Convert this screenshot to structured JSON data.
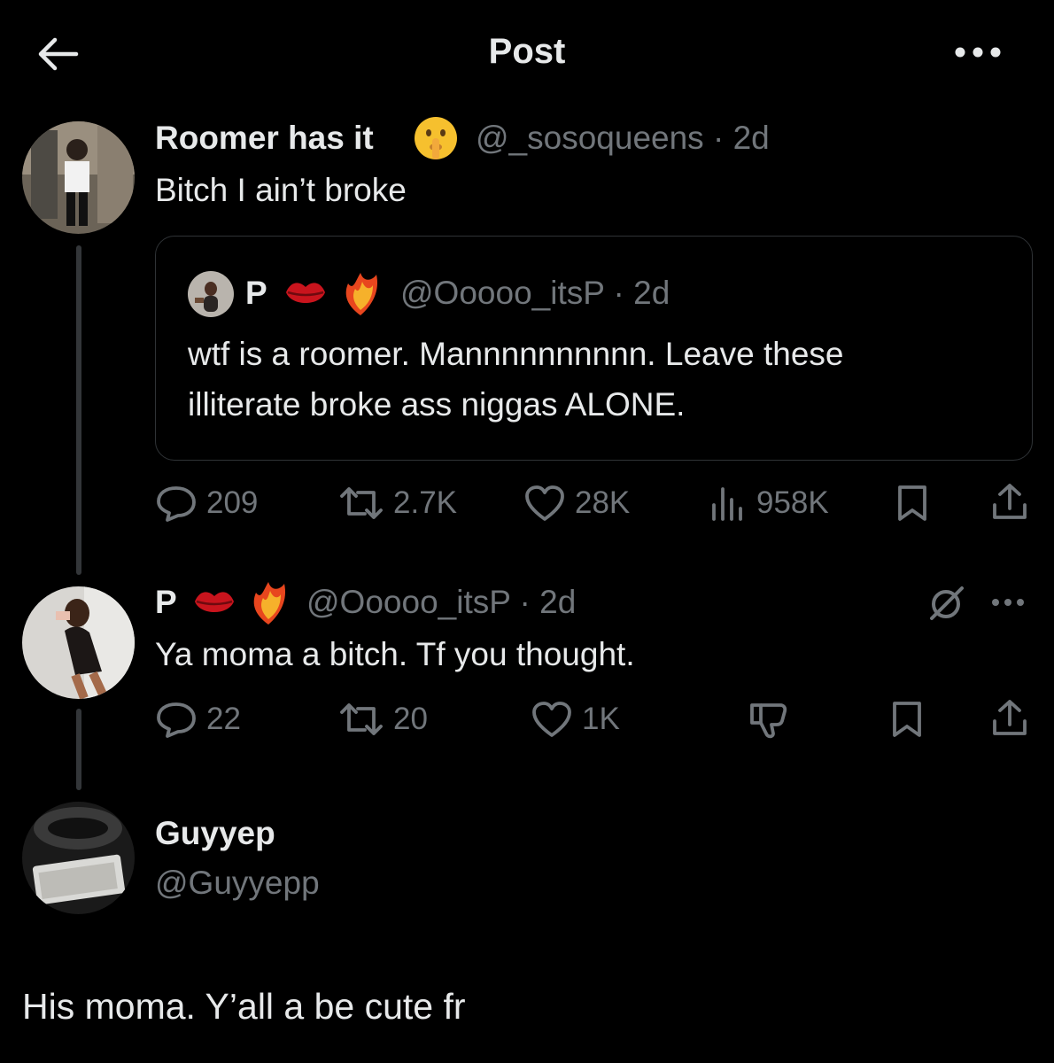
{
  "header": {
    "title": "Post"
  },
  "main_post": {
    "name": "Roomer has it",
    "handle": "@_sosoqueens",
    "time": "2d",
    "text": "Bitch I ain’t broke",
    "quoted": {
      "name": "P",
      "handle": "@Ooooo_itsP",
      "time": "2d",
      "text_line1": "wtf is a roomer. Mannnnnnnnnn. Leave these",
      "text_line2": "illiterate broke ass niggas ALONE."
    },
    "stats": {
      "replies": "209",
      "reposts": "2.7K",
      "likes": "28K",
      "views": "958K"
    }
  },
  "reply": {
    "name": "P",
    "handle": "@Ooooo_itsP",
    "time": "2d",
    "text": "Ya moma a bitch. Tf you thought.",
    "stats": {
      "replies": "22",
      "reposts": "20",
      "likes": "1K"
    }
  },
  "composer": {
    "name": "Guyyep",
    "handle": "@Guyyepp",
    "text": "His moma. Y’all a be cute fr"
  },
  "colors": {
    "background": "#000000",
    "primary_text": "#e7e9ea",
    "secondary_text": "#71767b",
    "divider": "#2f3336"
  },
  "icons": [
    "back-arrow-icon",
    "more-icon",
    "shush-emoji-icon",
    "lips-emoji-icon",
    "phoenix-emoji-icon",
    "reply-icon",
    "repost-icon",
    "like-icon",
    "views-icon",
    "bookmark-icon",
    "share-icon",
    "grok-icon",
    "dislike-icon"
  ]
}
